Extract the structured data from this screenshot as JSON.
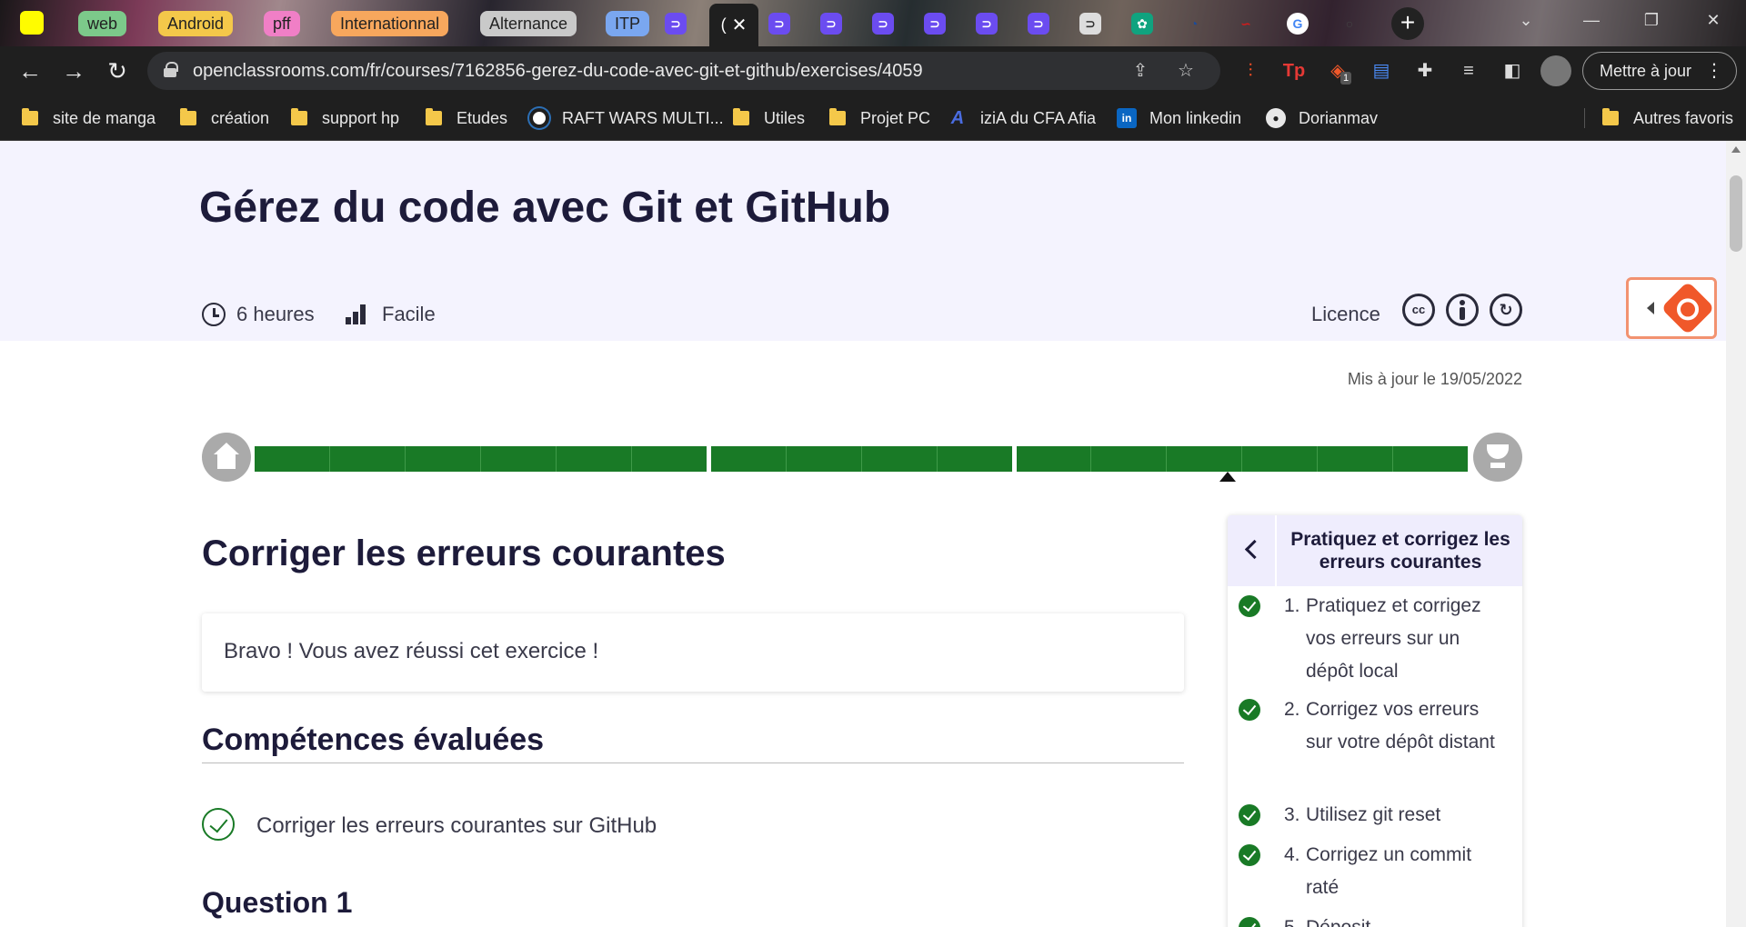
{
  "browser": {
    "tab_groups": [
      {
        "label": "web",
        "color": "#7cc98a"
      },
      {
        "label": "Android",
        "color": "#f4c84a"
      },
      {
        "label": "pff",
        "color": "#f07fc6"
      },
      {
        "label": "Internationnal",
        "color": "#f7a75d"
      },
      {
        "label": "Alternance",
        "color": "#c9c9c9"
      },
      {
        "label": "ITP",
        "color": "#7aa7f0"
      }
    ],
    "active_tab_icon": "(",
    "active_tab_close": "✕",
    "new_tab_symbol": "+",
    "url": "openclassrooms.com/fr/courses/7162856-gerez-du-code-avec-git-et-github/exercises/4059",
    "update_button": "Mettre à jour",
    "extension_badge": "1",
    "bookmarks": [
      {
        "label": "site de manga",
        "icon": "folder-icon"
      },
      {
        "label": "création",
        "icon": "folder-icon"
      },
      {
        "label": "support hp",
        "icon": "folder-icon"
      },
      {
        "label": "Etudes",
        "icon": "folder-icon"
      },
      {
        "label": "RAFT WARS MULTI...",
        "icon": "raft-wars-icon"
      },
      {
        "label": "Utiles",
        "icon": "folder-icon"
      },
      {
        "label": "Projet PC",
        "icon": "folder-icon"
      },
      {
        "label": "iziA du CFA Afia",
        "icon": "izia-icon"
      },
      {
        "label": "Mon linkedin",
        "icon": "linkedin-icon"
      },
      {
        "label": "Dorianmav",
        "icon": "github-icon"
      }
    ],
    "other_bookmarks": "Autres favoris"
  },
  "course": {
    "title": "Gérez du code avec Git et GitHub",
    "duration": "6 heures",
    "difficulty": "Facile",
    "licence_label": "Licence",
    "licence_icons": [
      "cc",
      "by",
      "sa"
    ],
    "updated": "Mis à jour le 19/05/2022"
  },
  "progress": {
    "segments": [
      6,
      4,
      6
    ],
    "completed": 1.0
  },
  "main": {
    "chapter_title": "Corriger les erreurs courantes",
    "success_message": "Bravo ! Vous avez réussi cet exercice !",
    "skills_heading": "Compétences évaluées",
    "skill": "Corriger les erreurs courantes sur GitHub",
    "question_heading": "Question 1"
  },
  "side_panel": {
    "title": "Pratiquez et corrigez les erreurs courantes",
    "items": [
      {
        "num": "1.",
        "text": "Pratiquez et corrigez vos erreurs sur un dépôt local"
      },
      {
        "num": "2.",
        "text": "Corrigez vos erreurs sur votre dépôt distant"
      },
      {
        "num": "3.",
        "text": "Utilisez git reset"
      },
      {
        "num": "4.",
        "text": "Corrigez un commit raté"
      },
      {
        "num": "5.",
        "text": "Déposit..."
      }
    ]
  },
  "colors": {
    "accent_green": "#197a26",
    "title_color": "#1d1b3a",
    "hero_bg": "#f4f3fe"
  }
}
